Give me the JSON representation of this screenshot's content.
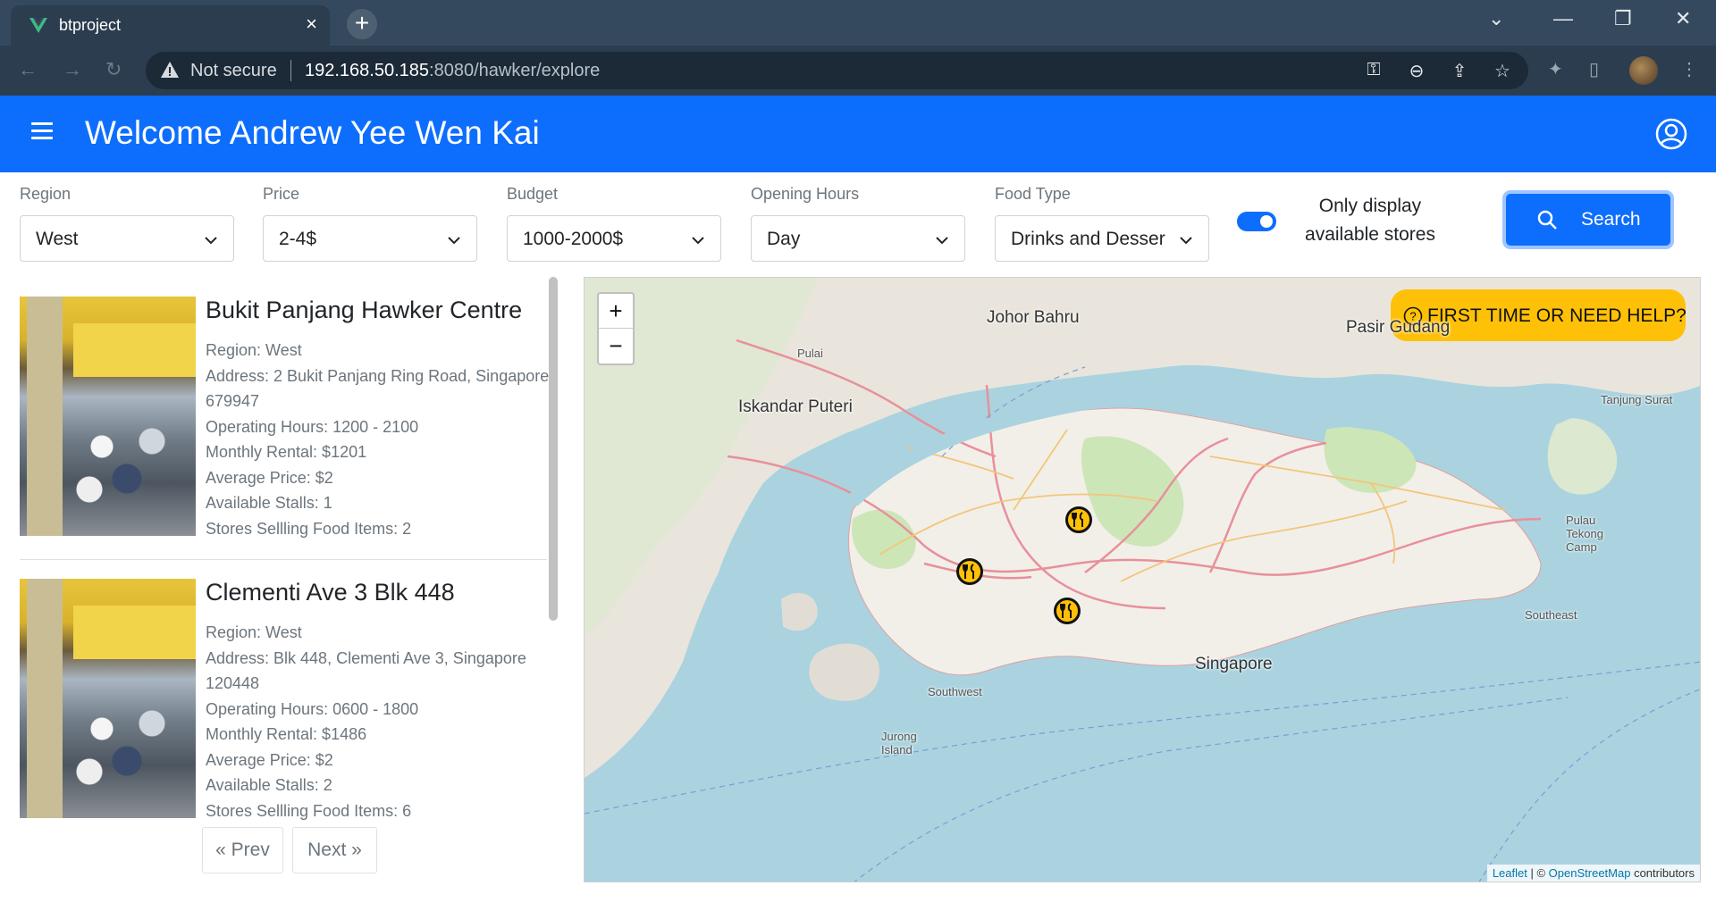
{
  "browser": {
    "tab_title": "btproject",
    "security_text": "Not secure",
    "url_host": "192.168.50.185",
    "url_path": ":8080/hawker/explore"
  },
  "header": {
    "welcome": "Welcome Andrew Yee Wen Kai"
  },
  "filters": [
    {
      "label": "Region",
      "value": "West"
    },
    {
      "label": "Price",
      "value": "2-4$"
    },
    {
      "label": "Budget",
      "value": "1000-2000$"
    },
    {
      "label": "Opening Hours",
      "value": "Day"
    },
    {
      "label": "Food Type",
      "value": "Drinks and Desser"
    }
  ],
  "toggle": {
    "line1": "Only display",
    "line2": "available stores",
    "on": true
  },
  "search_label": "Search",
  "listings": [
    {
      "name": "Bukit Panjang Hawker Centre",
      "region": "Region: West",
      "address": "Address: 2 Bukit Panjang Ring Road, Singapore 679947",
      "hours": "Operating Hours: 1200 - 2100",
      "rental": "Monthly Rental: $1201",
      "price": "Average Price: $2",
      "stalls": "Available Stalls: 1",
      "food_items": "Stores Sellling Food Items: 2"
    },
    {
      "name": "Clementi Ave 3 Blk 448",
      "region": "Region: West",
      "address": "Address: Blk 448, Clementi Ave 3, Singapore 120448",
      "hours": "Operating Hours: 0600 - 1800",
      "rental": "Monthly Rental: $1486",
      "price": "Average Price: $2",
      "stalls": "Available Stalls: 2",
      "food_items": "Stores Sellling Food Items: 6"
    }
  ],
  "pagination": {
    "prev": "« Prev",
    "next": "Next »"
  },
  "map": {
    "zoom_in": "+",
    "zoom_out": "−",
    "help_label": "FIRST TIME OR NEED HELP?",
    "labels": {
      "johor_bahru": "Johor Bahru",
      "pasir_gudang": "Pasir Gudang",
      "iskandar_puteri": "Iskandar Puteri",
      "singapore": "Singapore",
      "pulai": "Pulai",
      "tanjung_surat": "Tanjung Surat",
      "jurong_island": "Jurong Island",
      "pulau_tekong": "Pulau Tekong Camp",
      "southwest": "Southwest",
      "southeast": "Southeast"
    },
    "attribution": {
      "leaflet": "Leaflet",
      "separator": " | © ",
      "osm": "OpenStreetMap",
      "suffix": " contributors"
    }
  }
}
